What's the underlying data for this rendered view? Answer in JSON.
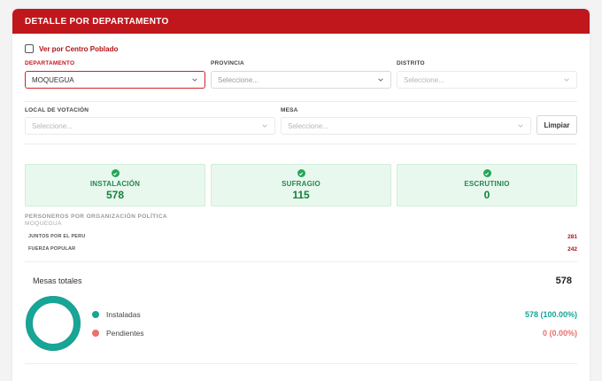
{
  "header": {
    "title": "DETALLE POR DEPARTAMENTO"
  },
  "filters": {
    "centro_poblado_label": "Ver por Centro Poblado",
    "departamento": {
      "label": "DEPARTAMENTO",
      "value": "MOQUEGUA"
    },
    "provincia": {
      "label": "PROVINCIA",
      "placeholder": "Seleccione..."
    },
    "distrito": {
      "label": "DISTRITO",
      "placeholder": "Seleccione..."
    },
    "local": {
      "label": "LOCAL DE VOTACIÓN",
      "placeholder": "Seleccione..."
    },
    "mesa": {
      "label": "MESA",
      "placeholder": "Seleccione..."
    },
    "clear_label": "Limpiar"
  },
  "cards": [
    {
      "title": "INSTALACIÓN",
      "value": "578"
    },
    {
      "title": "SUFRAGIO",
      "value": "115"
    },
    {
      "title": "ESCRUTINIO",
      "value": "0"
    }
  ],
  "personeros": {
    "title": "PERSONEROS POR ORGANIZACIÓN POLÍTICA",
    "subtitle": "MOQUEGUA",
    "parties": [
      {
        "name": "JUNTOS POR EL PERU",
        "value": "281"
      },
      {
        "name": "FUERZA POPULAR",
        "value": "242"
      }
    ]
  },
  "mesas": {
    "label": "Mesas totales",
    "total": "578",
    "legend": [
      {
        "name": "Instaladas",
        "value": "578 (100.00%)",
        "color": "#16a596",
        "fraction": 1.0
      },
      {
        "name": "Pendientes",
        "value": "0 (0.00%)",
        "color": "#e8716c",
        "fraction": 0.0
      }
    ]
  }
}
